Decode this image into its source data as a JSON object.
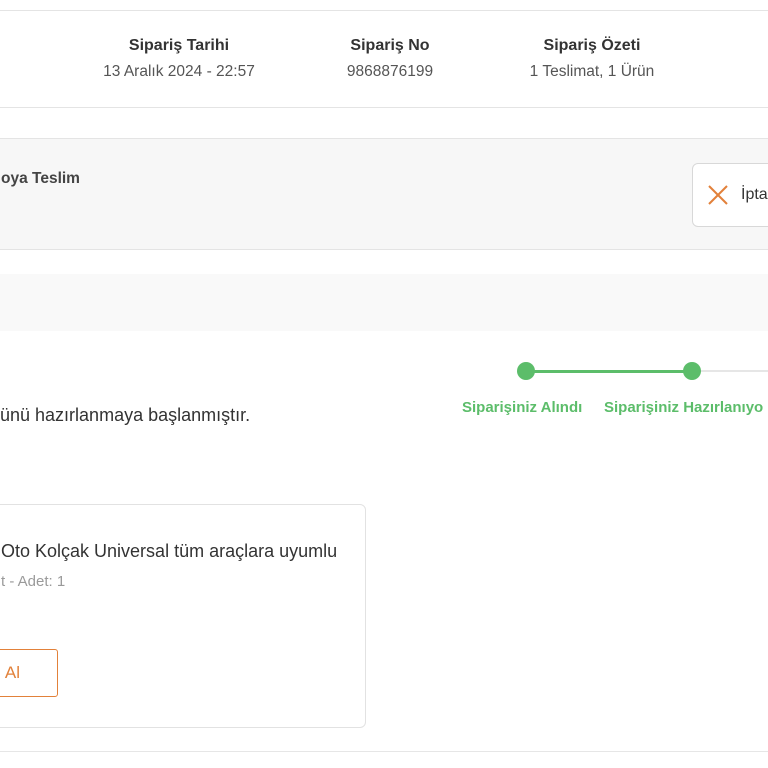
{
  "order_summary": {
    "date_label": "Sipariş Tarihi",
    "date_value": "13 Aralık 2024 - 22:57",
    "number_label": "Sipariş No",
    "number_value": "9868876199",
    "summary_label": "Sipariş Özeti",
    "summary_value": "1 Teslimat, 1 Ürün"
  },
  "delivery": {
    "title": "oya Teslim",
    "cancel_label": "İpta"
  },
  "status": {
    "text": "ünü hazırlanmaya başlanmıştır."
  },
  "stepper": {
    "steps": [
      {
        "label": "Siparişiniz Alındı",
        "done": true
      },
      {
        "label": "Siparişiniz Hazırlanıyo",
        "done": true
      }
    ],
    "accent_color": "#5cbd6a"
  },
  "product": {
    "name": "Oto Kolçak Universal tüm araçlara uyumlu",
    "meta": "t - Adet: 1",
    "buy_again_label": "Al",
    "accent_color": "#e2813a"
  }
}
